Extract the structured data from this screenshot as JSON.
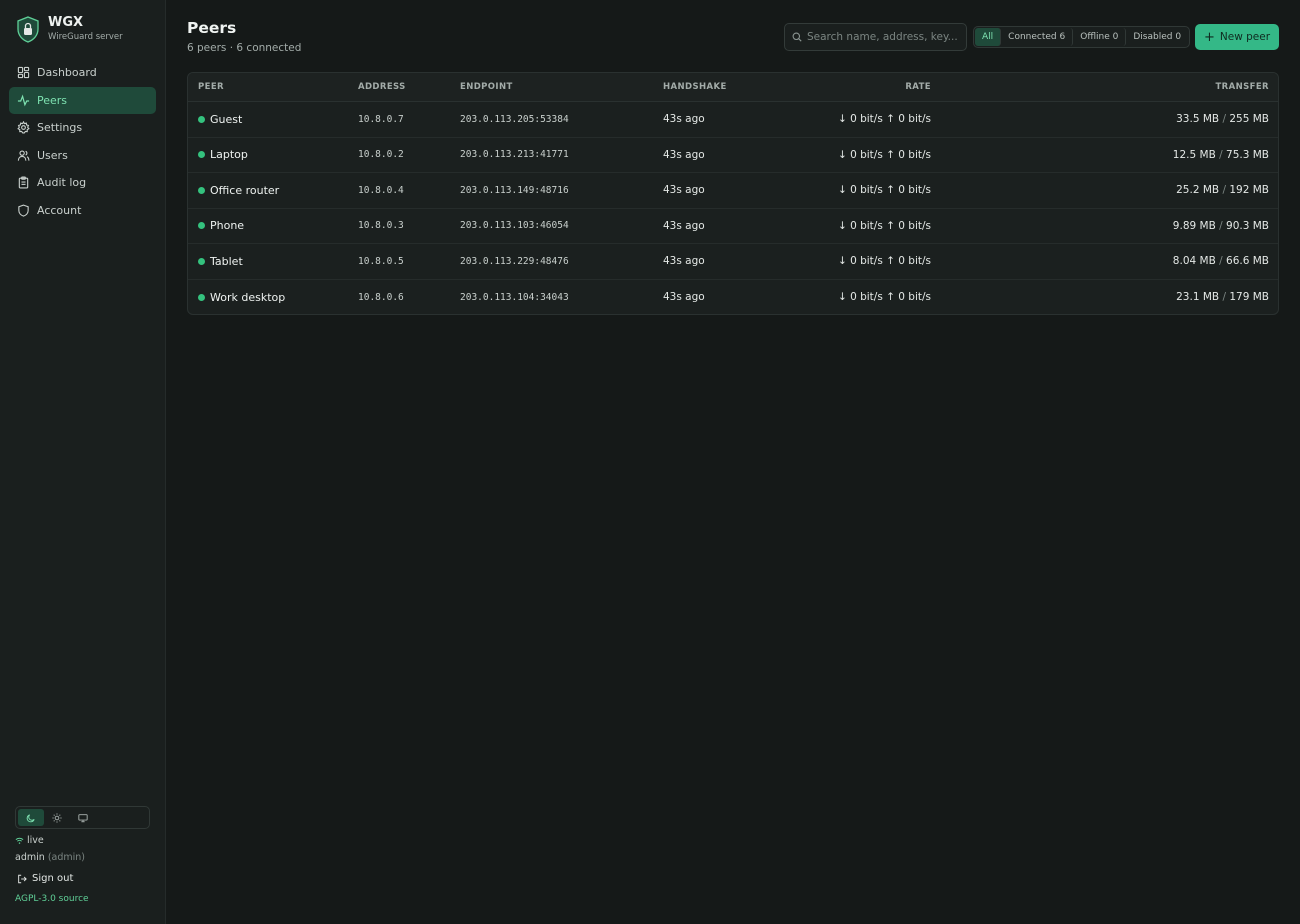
{
  "brand": {
    "name": "WGX",
    "subtitle": "WireGuard server"
  },
  "sidebar": {
    "items": [
      {
        "label": "Dashboard",
        "icon": "dashboard-icon"
      },
      {
        "label": "Peers",
        "icon": "activity-icon",
        "active": true
      },
      {
        "label": "Settings",
        "icon": "gear-icon"
      },
      {
        "label": "Users",
        "icon": "users-icon"
      },
      {
        "label": "Audit log",
        "icon": "clipboard-icon"
      },
      {
        "label": "Account",
        "icon": "shield-icon"
      }
    ],
    "status": "live",
    "user": {
      "name": "admin",
      "role": "(admin)"
    },
    "signout": "Sign out",
    "source": "AGPL-3.0 source"
  },
  "header": {
    "title": "Peers",
    "subtitle": "6 peers · 6 connected"
  },
  "search": {
    "placeholder": "Search name, address, key..."
  },
  "filters": [
    {
      "label": "All",
      "active": true
    },
    {
      "label": "Connected 6"
    },
    {
      "label": "Offline 0"
    },
    {
      "label": "Disabled 0"
    }
  ],
  "new_peer_label": "New peer",
  "table": {
    "columns": [
      "PEER",
      "ADDRESS",
      "ENDPOINT",
      "HANDSHAKE",
      "RATE",
      "TRANSFER"
    ],
    "rows": [
      {
        "name": "Guest",
        "address": "10.8.0.7",
        "endpoint": "203.0.113.205:53384",
        "handshake": "43s ago",
        "rate": "↓ 0 bit/s ↑ 0 bit/s",
        "rx": "33.5 MB",
        "tx": "255 MB"
      },
      {
        "name": "Laptop",
        "address": "10.8.0.2",
        "endpoint": "203.0.113.213:41771",
        "handshake": "43s ago",
        "rate": "↓ 0 bit/s ↑ 0 bit/s",
        "rx": "12.5 MB",
        "tx": "75.3 MB"
      },
      {
        "name": "Office router",
        "address": "10.8.0.4",
        "endpoint": "203.0.113.149:48716",
        "handshake": "43s ago",
        "rate": "↓ 0 bit/s ↑ 0 bit/s",
        "rx": "25.2 MB",
        "tx": "192 MB"
      },
      {
        "name": "Phone",
        "address": "10.8.0.3",
        "endpoint": "203.0.113.103:46054",
        "handshake": "43s ago",
        "rate": "↓ 0 bit/s ↑ 0 bit/s",
        "rx": "9.89 MB",
        "tx": "90.3 MB"
      },
      {
        "name": "Tablet",
        "address": "10.8.0.5",
        "endpoint": "203.0.113.229:48476",
        "handshake": "43s ago",
        "rate": "↓ 0 bit/s ↑ 0 bit/s",
        "rx": "8.04 MB",
        "tx": "66.6 MB"
      },
      {
        "name": "Work desktop",
        "address": "10.8.0.6",
        "endpoint": "203.0.113.104:34043",
        "handshake": "43s ago",
        "rate": "↓ 0 bit/s ↑ 0 bit/s",
        "rx": "23.1 MB",
        "tx": "179 MB"
      }
    ]
  },
  "colors": {
    "accent": "#34b887",
    "status_online": "#34c27e",
    "background": "#151918"
  }
}
